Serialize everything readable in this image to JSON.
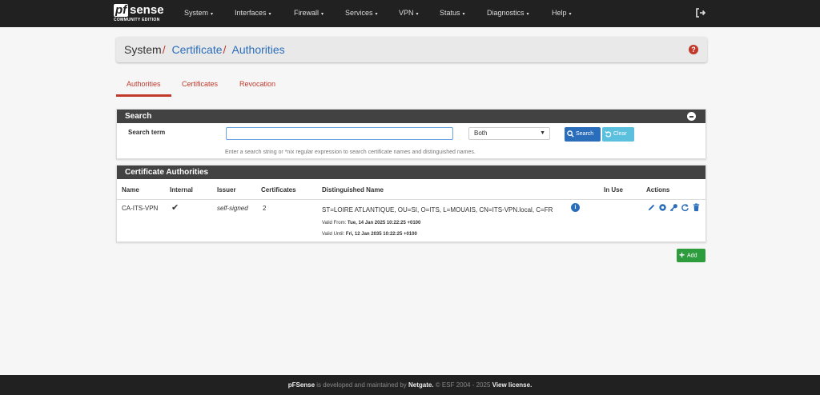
{
  "nav": {
    "logo_pf": "pf",
    "logo_sense": "sense",
    "logo_edition": "COMMUNITY EDITION",
    "menu": [
      "System",
      "Interfaces",
      "Firewall",
      "Services",
      "VPN",
      "Status",
      "Diagnostics",
      "Help"
    ],
    "caret": "▾"
  },
  "breadcrumb": {
    "root": "System",
    "sep": "/",
    "link1": "Certificate",
    "link2": "Authorities",
    "help": "?"
  },
  "tabs": [
    "Authorities",
    "Certificates",
    "Revocation"
  ],
  "search": {
    "title": "Search",
    "term_label": "Search term",
    "term_value": "",
    "scope_selected": "Both",
    "search_button": "Search",
    "clear_button": "Clear",
    "help": "Enter a search string or *nix regular expression to search certificate names and distinguished names."
  },
  "ca_table": {
    "title": "Certificate Authorities",
    "headers": [
      "Name",
      "Internal",
      "Issuer",
      "Certificates",
      "Distinguished Name",
      "In Use",
      "Actions"
    ],
    "rows": [
      {
        "name": "CA-ITS-VPN",
        "internal": "✔",
        "issuer": "self-signed",
        "certificates": "2",
        "dn": "ST=LOIRE ATLANTIQUE, OU=SI, O=ITS, L=MOUAIS, CN=ITS-VPN.local, C=FR",
        "valid_from_label": "Valid From:",
        "valid_from": "Tue, 14 Jan 2025 10:22:25 +0100",
        "valid_until_label": "Valid Until:",
        "valid_until": "Fri, 12 Jan 2035 10:22:25 +0100",
        "in_use": ""
      }
    ]
  },
  "add_button": "Add",
  "footer": {
    "brand": "pFSense",
    "text1": " is developed and maintained by ",
    "company": "Netgate.",
    "text2": " © ESF 2004 - 2025 ",
    "license": "View license."
  },
  "colors": {
    "navbar": "#212121",
    "accent_red": "#c0392b",
    "link_blue": "#2a6ebb",
    "panel_header": "#424242",
    "add_green": "#2d9c3d",
    "clear_cyan": "#5bc0de"
  }
}
